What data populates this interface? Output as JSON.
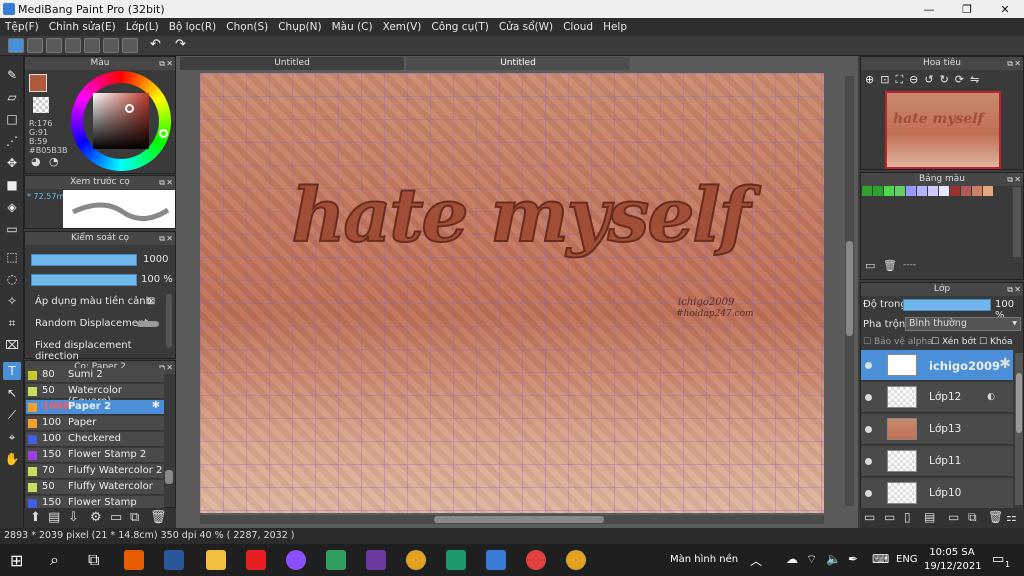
{
  "window": {
    "title": "MediBang Paint Pro (32bit)",
    "minimize": "—",
    "restore": "❐",
    "close": "✕"
  },
  "menu": [
    "Tệp(F)",
    "Chỉnh sửa(E)",
    "Lớp(L)",
    "Bộ lọc(R)",
    "Chọn(S)",
    "Chụp(N)",
    "Màu (C)",
    "Xem(V)",
    "Công cụ(T)",
    "Cửa sổ(W)",
    "Cloud",
    "Help"
  ],
  "tabs": [
    "Untitled",
    "Untitled"
  ],
  "color_panel": {
    "title": "Màu",
    "r": "R:176",
    "g": "G:91",
    "b": "B:59",
    "hex": "#B05B3B",
    "fg": "#b05b3b"
  },
  "brush_preview": {
    "title": "Xem trước cọ",
    "size": "72.57m"
  },
  "brush_control": {
    "title": "Kiểm soát cọ",
    "size_value": "1000",
    "opacity_value": "100 %",
    "apply_color": "Áp dụng màu tiền cảnh",
    "random_disp": "Random Displacement",
    "fixed_disp": "Fixed displacement direction"
  },
  "brush_list": {
    "title": "Cọ: Paper 2",
    "items": [
      {
        "size": "80",
        "name": "Sumi 2",
        "color": "#c8c830"
      },
      {
        "size": "50",
        "name": "Watercolor (Square)",
        "color": "#c8e060"
      },
      {
        "size": "1000",
        "name": "Paper 2",
        "color": "#f0a030"
      },
      {
        "size": "100",
        "name": "Paper",
        "color": "#f0a030"
      },
      {
        "size": "100",
        "name": "Checkered",
        "color": "#4060e0"
      },
      {
        "size": "150",
        "name": "Flower Stamp 2",
        "color": "#a040e0"
      },
      {
        "size": "70",
        "name": "Fluffy Watercolor 2",
        "color": "#c8e060"
      },
      {
        "size": "50",
        "name": "Fluffy Watercolor",
        "color": "#c8e060"
      },
      {
        "size": "150",
        "name": "Flower Stamp",
        "color": "#4060e0"
      }
    ]
  },
  "canvas": {
    "headline": "hate myself",
    "watermark1": "ichigo2009",
    "watermark2": "#hoidap247.com"
  },
  "navigator": {
    "title": "Hoa tiêu",
    "thumb_text": "hate myself"
  },
  "palette": {
    "title": "Bảng màu",
    "label": "----",
    "colors": [
      "#33a02c",
      "#2ca02c",
      "#4cd94c",
      "#66cc66",
      "#9999ff",
      "#b3b3ff",
      "#ccccff",
      "#e6e6ff",
      "#993333",
      "#b35959",
      "#cc8066",
      "#e6a680"
    ]
  },
  "layer_panel": {
    "title": "Lớp",
    "opacity_label": "Độ trong",
    "opacity_value": "100 %",
    "blend_label": "Pha trộn",
    "blend_value": "Bình thường",
    "protect_alpha": "Bảo vệ alpha",
    "clipping": "Xén bớt",
    "lock": "Khóa",
    "layers": [
      {
        "name": "ichigo2009"
      },
      {
        "name": "Lớp12"
      },
      {
        "name": "Lớp13"
      },
      {
        "name": "Lớp11"
      },
      {
        "name": "Lớp10"
      }
    ]
  },
  "status": {
    "text": "2893 * 2039 pixel   (21 * 14.8cm)   350 dpi   40 %   ( 2287, 2032 )"
  },
  "taskbar": {
    "desktop_label": "Màn hình nền",
    "lang": "ENG",
    "time": "10:05 SA",
    "date": "19/12/2021",
    "notif_count": "1"
  }
}
